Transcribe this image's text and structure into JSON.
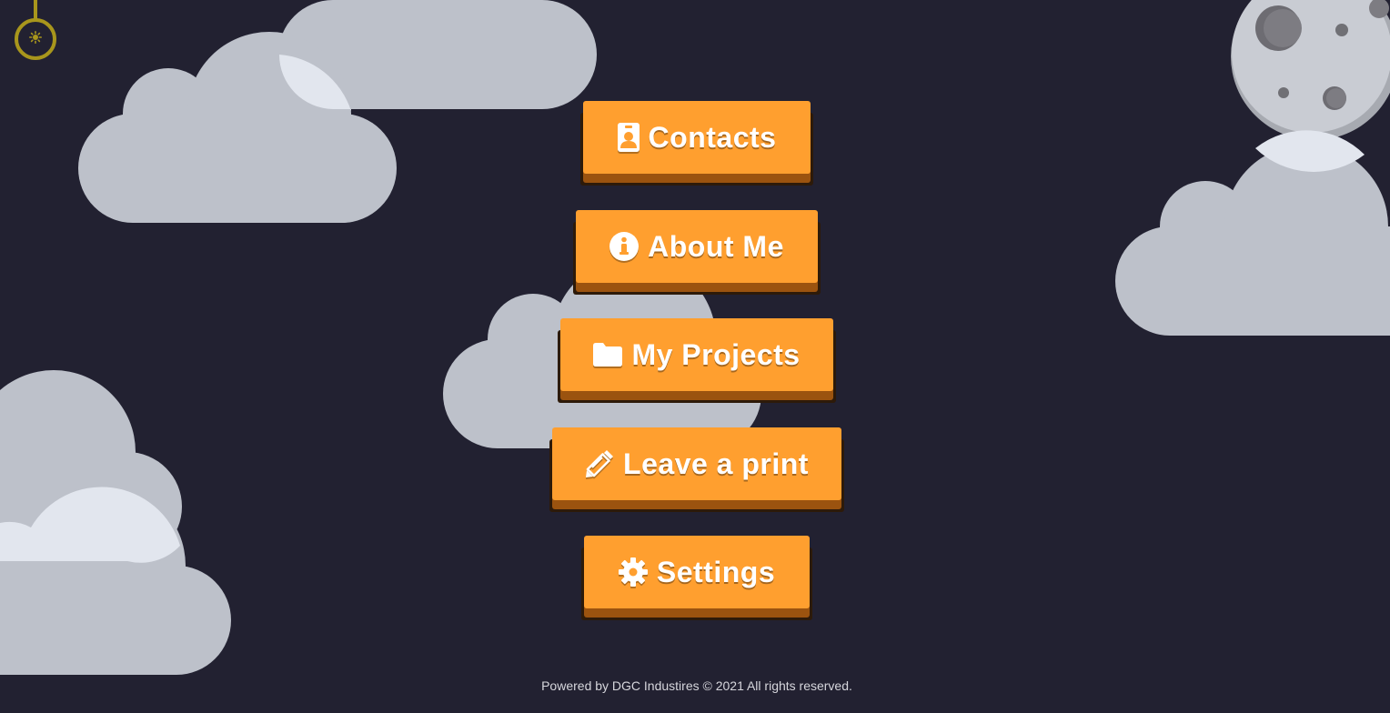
{
  "menu": {
    "items": [
      {
        "label": "Contacts",
        "icon": "contact-card-icon"
      },
      {
        "label": "About Me",
        "icon": "info-icon"
      },
      {
        "label": "My Projects",
        "icon": "folder-icon"
      },
      {
        "label": "Leave a print",
        "icon": "pencil-icon"
      },
      {
        "label": "Settings",
        "icon": "gear-icon"
      }
    ]
  },
  "footer": {
    "text": "Powered by DGC Industires © 2021 All rights reserved."
  },
  "theme_toggle": {
    "icon": "sun-icon"
  },
  "colors": {
    "background": "#222131",
    "button": "#ff9f2f",
    "button_shadow": "#9b530f",
    "cloud": "#bdc1ca",
    "moon": "#c9ccd3",
    "toggle": "#a8961c"
  }
}
